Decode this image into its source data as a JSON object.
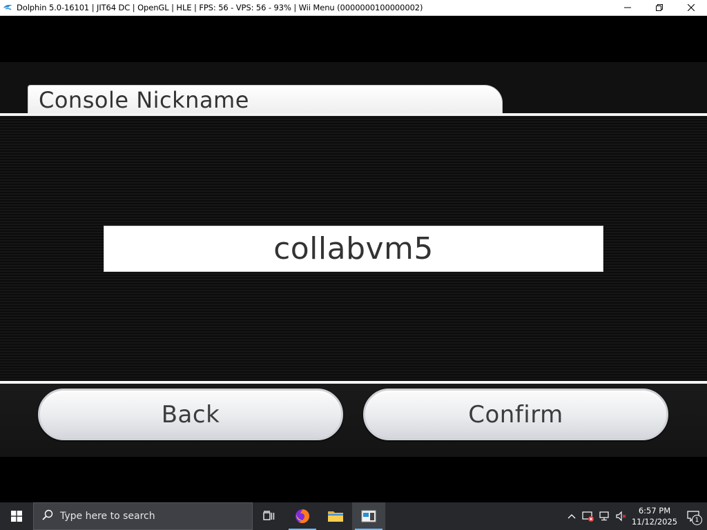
{
  "window": {
    "title": "Dolphin 5.0-16101 | JIT64 DC | OpenGL | HLE | FPS: 56 - VPS: 56 - 93% | Wii Menu (0000000100000002)",
    "icon": "dolphin-icon",
    "controls": [
      "minimize-icon",
      "restore-icon",
      "close-icon"
    ]
  },
  "screen": {
    "header_title": "Console Nickname",
    "nickname_value": "collabvm5",
    "back_label": "Back",
    "confirm_label": "Confirm"
  },
  "taskbar": {
    "search_placeholder": "Type here to search",
    "apps": [
      {
        "name": "task-view-icon",
        "running": false
      },
      {
        "name": "firefox-icon",
        "running": true
      },
      {
        "name": "file-explorer-icon",
        "running": false
      },
      {
        "name": "dolphin-taskbar-icon",
        "running": true,
        "active": true
      }
    ],
    "clock_time": "6:57 PM",
    "clock_date": "11/12/2025",
    "notification_count": "1"
  },
  "colors": {
    "taskbar_bg": "#26282c",
    "accent_underline": "#76b9ed",
    "firefox_underline": "#6ccf4f"
  }
}
